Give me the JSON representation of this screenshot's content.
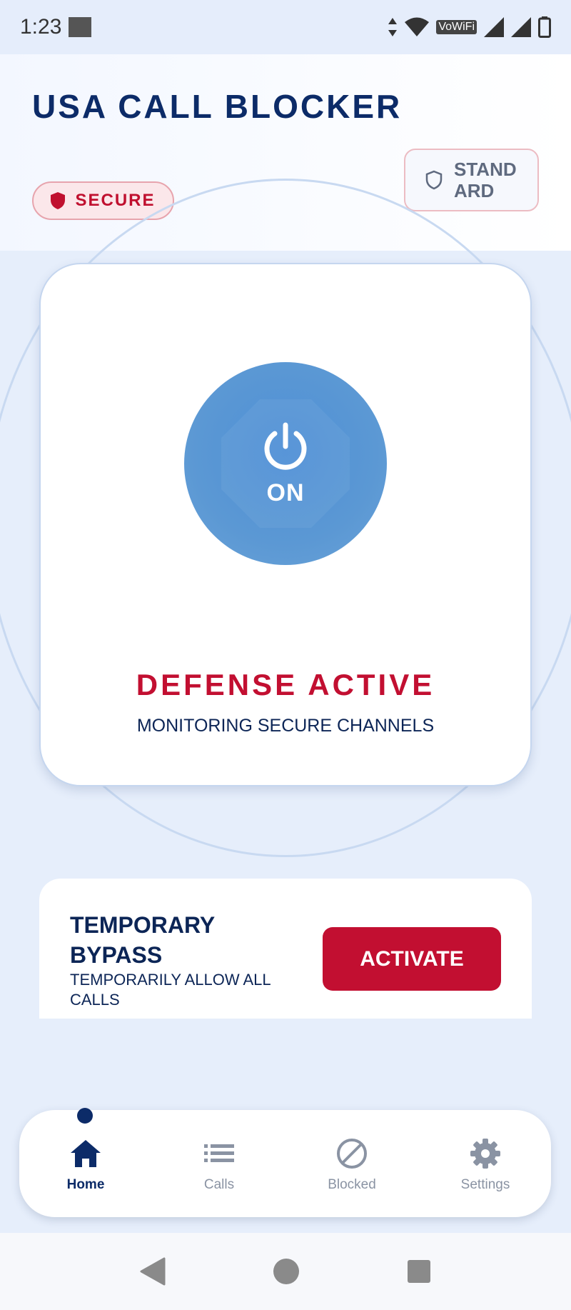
{
  "status_bar": {
    "time": "1:23",
    "network_label": "VoWiFi"
  },
  "header": {
    "title": "USA CALL BLOCKER",
    "badge": "SECURE",
    "mode_button": "STANDARD"
  },
  "power": {
    "state_label": "ON",
    "status_title": "DEFENSE ACTIVE",
    "status_subtitle": "MONITORING SECURE CHANNELS"
  },
  "bypass": {
    "title": "TEMPORARY BYPASS",
    "description": "TEMPORARILY ALLOW ALL CALLS",
    "button": "ACTIVATE"
  },
  "nav": {
    "items": [
      {
        "label": "Home",
        "icon": "home-icon",
        "active": true
      },
      {
        "label": "Calls",
        "icon": "list-icon",
        "active": false
      },
      {
        "label": "Blocked",
        "icon": "block-icon",
        "active": false
      },
      {
        "label": "Settings",
        "icon": "gear-icon",
        "active": false
      }
    ]
  },
  "colors": {
    "navy": "#0c2b68",
    "red": "#c20f31",
    "power_blue": "#5b98d4",
    "background": "#e6eefb"
  }
}
